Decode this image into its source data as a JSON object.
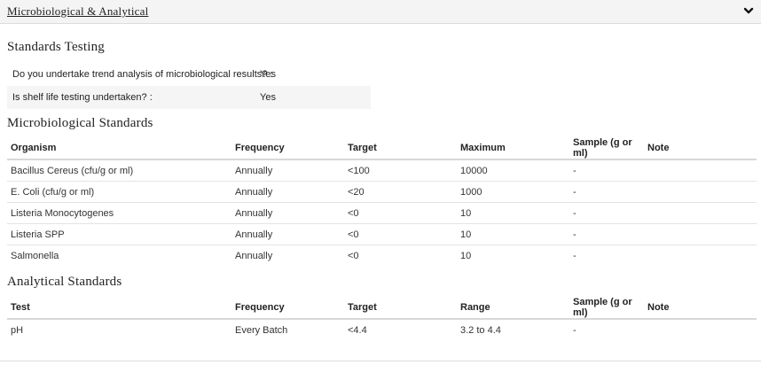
{
  "accordion": {
    "title": "Microbiological & Analytical"
  },
  "standards_testing": {
    "heading": "Standards Testing",
    "questions": [
      {
        "label": "Do you undertake trend analysis of microbiological results? :",
        "answer": "Yes"
      },
      {
        "label": "Is shelf life testing undertaken? :",
        "answer": "Yes"
      }
    ]
  },
  "microbiological": {
    "heading": "Microbiological Standards",
    "columns": [
      "Organism",
      "Frequency",
      "Target",
      "Maximum",
      "Sample (g or ml)",
      "Note"
    ],
    "rows": [
      [
        "Bacillus Cereus (cfu/g or ml)",
        "Annually",
        "<100",
        "10000",
        "-",
        ""
      ],
      [
        "E. Coli (cfu/g or ml)",
        "Annually",
        "<20",
        "1000",
        "-",
        ""
      ],
      [
        "Listeria Monocytogenes",
        "Annually",
        "<0",
        "10",
        "-",
        ""
      ],
      [
        "Listeria SPP",
        "Annually",
        "<0",
        "10",
        "-",
        ""
      ],
      [
        "Salmonella",
        "Annually",
        "<0",
        "10",
        "-",
        ""
      ]
    ]
  },
  "analytical": {
    "heading": "Analytical Standards",
    "columns": [
      "Test",
      "Frequency",
      "Target",
      "Range",
      "Sample (g or ml)",
      "Note"
    ],
    "rows": [
      [
        "pH",
        "Every Batch",
        "<4.4",
        "3.2 to 4.4",
        "-",
        ""
      ]
    ]
  },
  "icons": {
    "toggle": "chevron-down-icon"
  }
}
